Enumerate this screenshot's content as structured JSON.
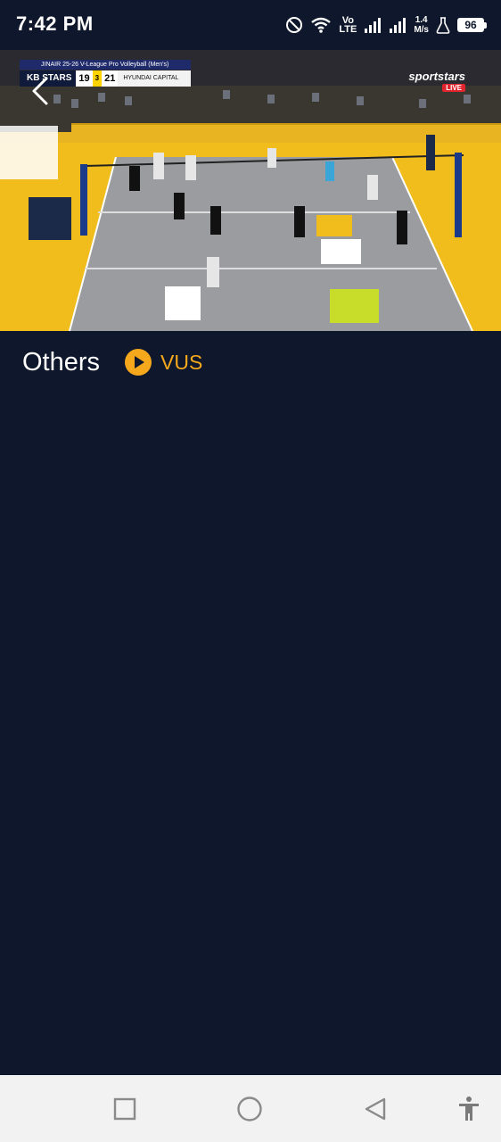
{
  "status_bar": {
    "time": "7:42 PM",
    "volte_top": "Vo",
    "volte_bottom": "LTE",
    "net_speed_value": "1.4",
    "net_speed_unit": "M/s",
    "battery": "96",
    "icons": [
      "do-not-disturb-icon",
      "wifi-icon",
      "signal-icon",
      "signal-icon",
      "flask-icon",
      "battery-icon"
    ]
  },
  "video": {
    "scoreboard": {
      "title": "JINAIR 25-26 V-League Pro Volleyball (Men's)",
      "home_team": "KB STARS",
      "home_score": "19",
      "set": "3",
      "away_score": "21",
      "away_team": "HYUNDAI CAPITAL"
    },
    "broadcaster": "sportstars",
    "live_label": "LIVE"
  },
  "match_info": {
    "title": "Others",
    "league": "VUS",
    "accent_color": "#f6a81c"
  },
  "nav_bar": {
    "buttons": [
      "recents",
      "home",
      "back",
      "accessibility"
    ]
  }
}
